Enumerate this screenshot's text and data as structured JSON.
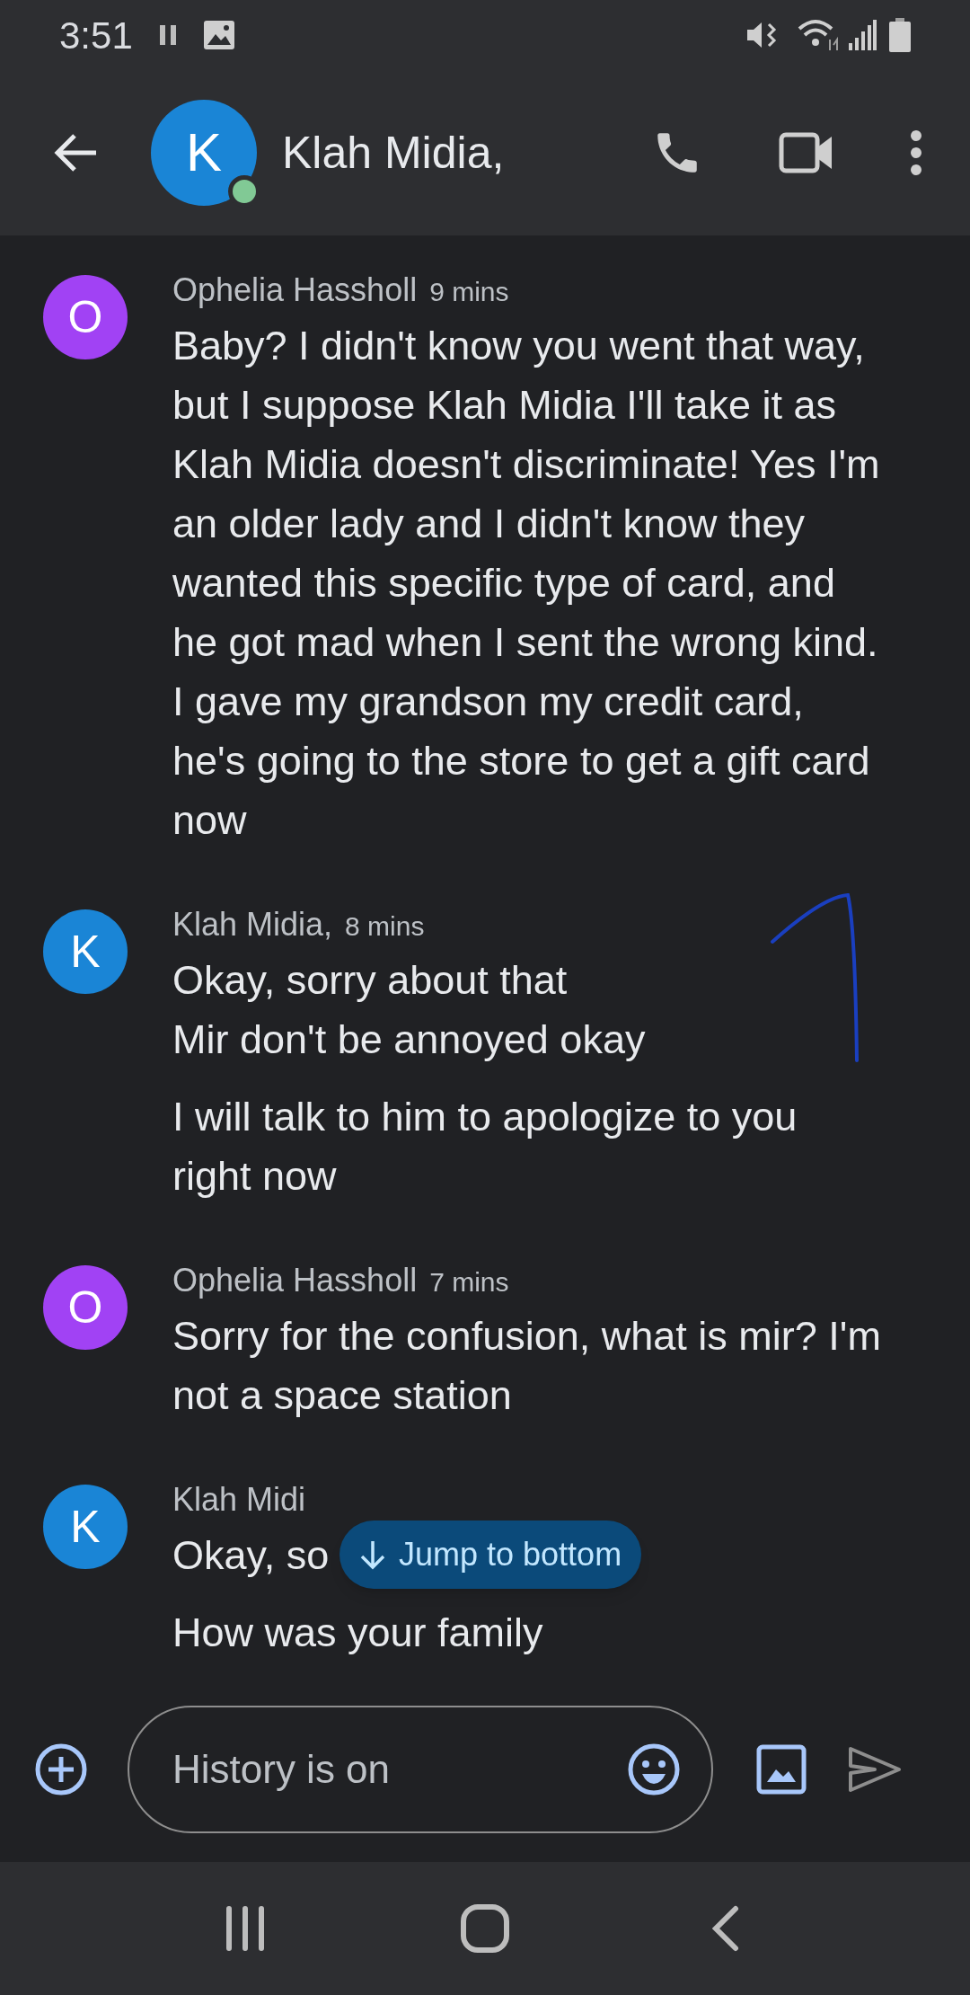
{
  "status_bar": {
    "time": "3:51"
  },
  "header": {
    "avatar_letter": "K",
    "title": "Klah Midia,",
    "online": true
  },
  "messages": [
    {
      "avatar_letter": "O",
      "color": "#a142f4",
      "sender": "Ophelia Hassholl",
      "time": "9 mins",
      "paragraphs": [
        "Baby? I didn't know you went that way, but I suppose Klah Midia I'll take it as Klah Midia doesn't discriminate! Yes I'm an older lady and I didn't know they wanted this specific type of card, and he got mad when I sent the wrong kind. I gave my grandson my credit card, he's going to the store to get a gift card now"
      ]
    },
    {
      "avatar_letter": "K",
      "color": "#1a85d6",
      "sender": "Klah Midia,",
      "time": "8 mins",
      "paragraphs": [
        "Okay, sorry about that\n Mir don't be annoyed okay",
        "I will talk to him to apologize to you right now"
      ]
    },
    {
      "avatar_letter": "O",
      "color": "#a142f4",
      "sender": "Ophelia Hassholl",
      "time": "7 mins",
      "paragraphs": [
        "Sorry for the confusion, what is mir? I'm not a space station"
      ]
    },
    {
      "avatar_letter": "K",
      "color": "#1a85d6",
      "sender": "Klah Midi",
      "paragraphs": [
        "Okay, so",
        " How was your family"
      ]
    }
  ],
  "jump_button": "Jump to bottom",
  "composer": {
    "placeholder": "History is on"
  }
}
